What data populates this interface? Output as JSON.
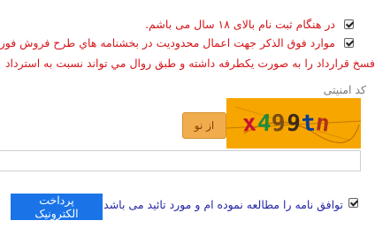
{
  "terms": {
    "age_confirmation": "در هنگام ثبت نام بالای ۱۸ سال می باشم.",
    "restrictions_line1": "موارد فوق الذکر جهت اعمال محدوديت در بخشنامه هاي طرح فروش فوري",
    "restrictions_line2": "فسخ قرارداد را به صورت يکطرفه داشته و طبق روال مي تواند نسبت به استرداد"
  },
  "security": {
    "label": "کد امنیتی",
    "refresh_label": "از نو",
    "captcha_text": "x499tn",
    "captcha_colors": [
      "#c8102e",
      "#1f8a3a",
      "#7a4b12",
      "#3a2a1a",
      "#0b3d91",
      "#b0301d"
    ],
    "input_value": ""
  },
  "agreement": {
    "label": "توافق نامه را مطالعه نموده ام و مورد تائید می باشد"
  },
  "payment": {
    "button_label": "پرداخت الکترونیک"
  }
}
